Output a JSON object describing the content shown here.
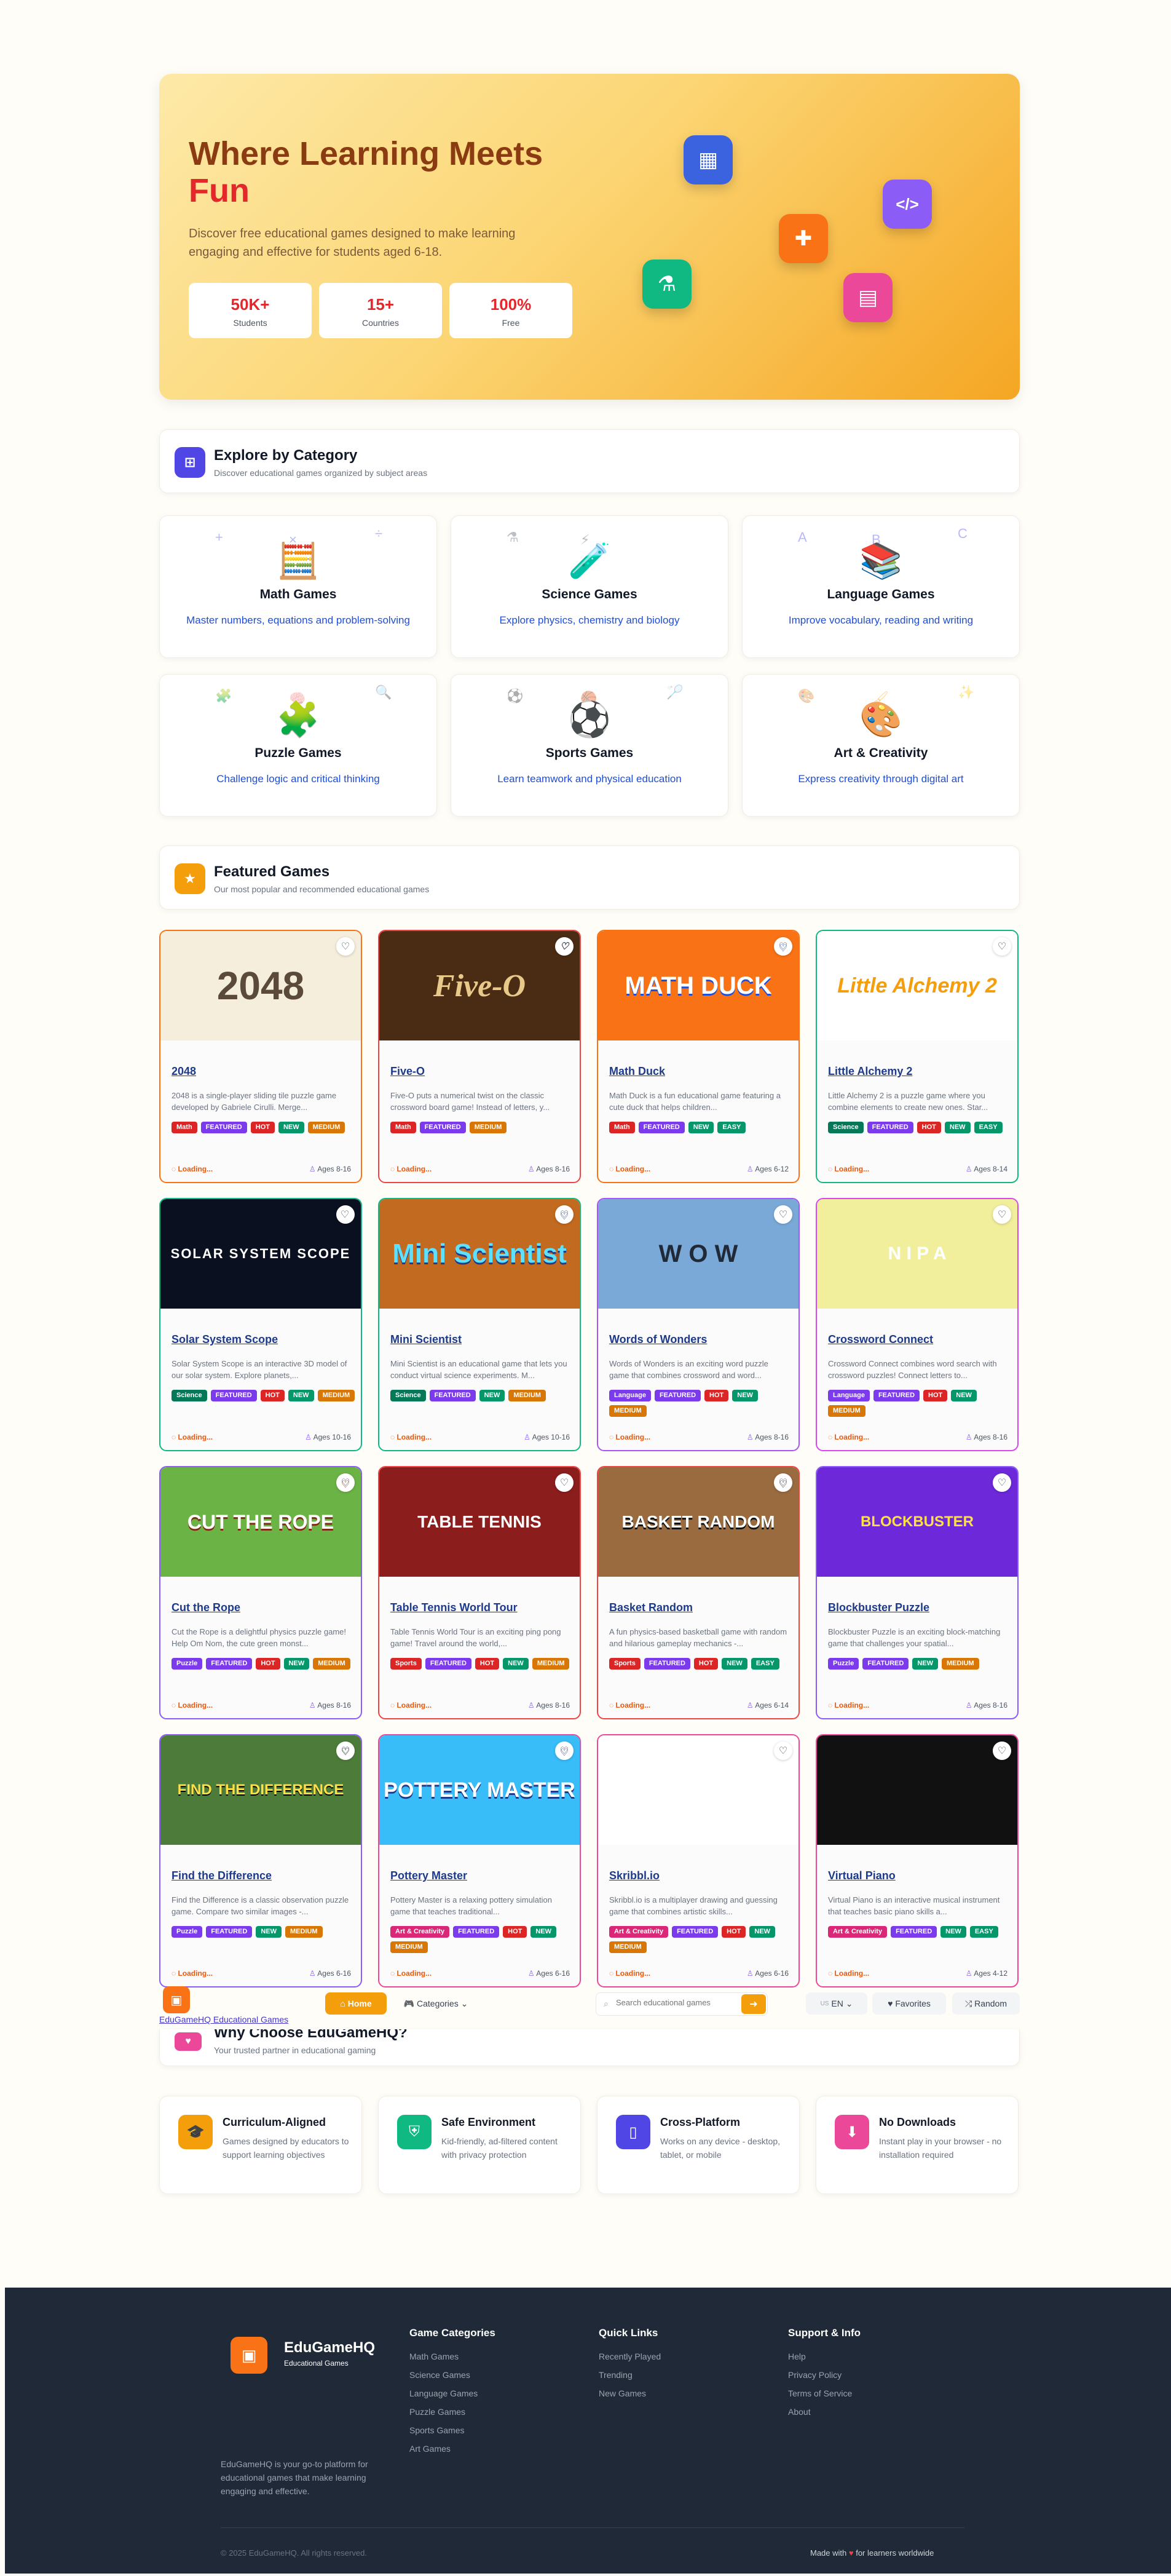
{
  "hero": {
    "title_line1": "Where Learning Meets",
    "title_line2": "Fun",
    "subtitle": "Discover free educational games designed to make learning engaging and effective for students aged 6-18.",
    "stats": [
      {
        "value": "50K+",
        "label": "Students"
      },
      {
        "value": "15+",
        "label": "Countries"
      },
      {
        "value": "100%",
        "label": "Free"
      }
    ],
    "icons": [
      "calculator-icon",
      "code-icon",
      "puzzle-icon",
      "flask-icon",
      "book-icon"
    ]
  },
  "categories_header": {
    "title": "Explore by Category",
    "subtitle": "Discover educational games organized by subject areas"
  },
  "categories": [
    {
      "name": "Math Games",
      "desc": "Master numbers, equations and problem-solving",
      "emoji": "🧮",
      "deco": [
        "+",
        "×",
        "÷"
      ]
    },
    {
      "name": "Science Games",
      "desc": "Explore physics, chemistry and biology",
      "emoji": "🧪",
      "deco": [
        "⚗",
        "⚡",
        ""
      ]
    },
    {
      "name": "Language Games",
      "desc": "Improve vocabulary, reading and writing",
      "emoji": "📚",
      "deco": [
        "A",
        "B",
        "C"
      ]
    },
    {
      "name": "Puzzle Games",
      "desc": "Challenge logic and critical thinking",
      "emoji": "🧩",
      "deco": [
        "🧩",
        "🧠",
        "🔍"
      ]
    },
    {
      "name": "Sports Games",
      "desc": "Learn teamwork and physical education",
      "emoji": "⚽",
      "deco": [
        "⚽",
        "🏀",
        "🏸"
      ]
    },
    {
      "name": "Art & Creativity",
      "desc": "Express creativity through digital art",
      "emoji": "🎨",
      "deco": [
        "🎨",
        "🖌",
        "✨"
      ]
    }
  ],
  "featured_header": {
    "title": "Featured Games",
    "subtitle": "Our most popular and recommended educational games"
  },
  "games": [
    {
      "title": "2048",
      "thumb": "2048",
      "desc": "2048 is a single-player sliding tile puzzle game developed by Gabriele Cirulli. Merge...",
      "tags": [
        "Math",
        "FEATURED",
        "HOT",
        "NEW",
        "MEDIUM"
      ],
      "ages": "Ages 8-16"
    },
    {
      "title": "Five-O",
      "thumb": "Five-O",
      "desc": "Five-O puts a numerical twist on the classic crossword board game! Instead of letters, y...",
      "tags": [
        "Math",
        "FEATURED",
        "MEDIUM"
      ],
      "ages": "Ages 8-16"
    },
    {
      "title": "Math Duck",
      "thumb": "MATH DUCK",
      "desc": "Math Duck is a fun educational game featuring a cute duck that helps children...",
      "tags": [
        "Math",
        "FEATURED",
        "NEW",
        "EASY"
      ],
      "ages": "Ages 6-12"
    },
    {
      "title": "Little Alchemy 2",
      "thumb": "Little Alchemy 2",
      "desc": "Little Alchemy 2 is a puzzle game where you combine elements to create new ones. Star...",
      "tags": [
        "Science",
        "FEATURED",
        "HOT",
        "NEW",
        "EASY"
      ],
      "ages": "Ages 8-14"
    },
    {
      "title": "Solar System Scope",
      "thumb": "SOLAR SYSTEM SCOPE",
      "desc": "Solar System Scope is an interactive 3D model of our solar system. Explore planets,...",
      "tags": [
        "Science",
        "FEATURED",
        "HOT",
        "NEW",
        "MEDIUM"
      ],
      "ages": "Ages 10-16"
    },
    {
      "title": "Mini Scientist",
      "thumb": "Mini Scientist",
      "desc": "Mini Scientist is an educational game that lets you conduct virtual science experiments. M...",
      "tags": [
        "Science",
        "FEATURED",
        "NEW",
        "MEDIUM"
      ],
      "ages": "Ages 10-16"
    },
    {
      "title": "Words of Wonders",
      "thumb": "W O W",
      "desc": "Words of Wonders is an exciting word puzzle game that combines crossword and word...",
      "tags": [
        "Language",
        "FEATURED",
        "HOT",
        "NEW",
        "MEDIUM"
      ],
      "ages": "Ages 8-16"
    },
    {
      "title": "Crossword Connect",
      "thumb": "N I P A",
      "desc": "Crossword Connect combines word search with crossword puzzles! Connect letters to...",
      "tags": [
        "Language",
        "FEATURED",
        "HOT",
        "NEW",
        "MEDIUM"
      ],
      "ages": "Ages 8-16"
    },
    {
      "title": "Cut the Rope",
      "thumb": "CUT THE ROPE",
      "desc": "Cut the Rope is a delightful physics puzzle game! Help Om Nom, the cute green monst...",
      "tags": [
        "Puzzle",
        "FEATURED",
        "HOT",
        "NEW",
        "MEDIUM"
      ],
      "ages": "Ages 8-16"
    },
    {
      "title": "Table Tennis World Tour",
      "thumb": "TABLE TENNIS",
      "desc": "Table Tennis World Tour is an exciting ping pong game! Travel around the world,...",
      "tags": [
        "Sports",
        "FEATURED",
        "HOT",
        "NEW",
        "MEDIUM"
      ],
      "ages": "Ages 8-16"
    },
    {
      "title": "Basket Random",
      "thumb": "BASKET RANDOM",
      "desc": "A fun physics-based basketball game with random and hilarious gameplay mechanics -...",
      "tags": [
        "Sports",
        "FEATURED",
        "HOT",
        "NEW",
        "EASY"
      ],
      "ages": "Ages 6-14"
    },
    {
      "title": "Blockbuster Puzzle",
      "thumb": "BLOCKBUSTER",
      "desc": "Blockbuster Puzzle is an exciting block-matching game that challenges your spatial...",
      "tags": [
        "Puzzle",
        "FEATURED",
        "NEW",
        "MEDIUM"
      ],
      "ages": "Ages 8-16"
    },
    {
      "title": "Find the Difference",
      "thumb": "FIND THE DIFFERENCE",
      "desc": "Find the Difference is a classic observation puzzle game. Compare two similar images -...",
      "tags": [
        "Puzzle",
        "FEATURED",
        "NEW",
        "MEDIUM"
      ],
      "ages": "Ages 6-16"
    },
    {
      "title": "Pottery Master",
      "thumb": "POTTERY MASTER",
      "desc": "Pottery Master is a relaxing pottery simulation game that teaches traditional...",
      "tags": [
        "Art & Creativity",
        "FEATURED",
        "HOT",
        "NEW",
        "MEDIUM"
      ],
      "ages": "Ages 6-16"
    },
    {
      "title": "Skribbl.io",
      "thumb": "",
      "desc": "Skribbl.io is a multiplayer drawing and guessing game that combines artistic skills...",
      "tags": [
        "Art & Creativity",
        "FEATURED",
        "HOT",
        "NEW",
        "MEDIUM"
      ],
      "ages": "Ages 6-16"
    },
    {
      "title": "Virtual Piano",
      "thumb": "",
      "desc": "Virtual Piano is an interactive musical instrument that teaches basic piano skills a...",
      "tags": [
        "Art & Creativity",
        "FEATURED",
        "NEW",
        "EASY"
      ],
      "ages": "Ages 4-12"
    }
  ],
  "loading_text": "Loading...",
  "navbar": {
    "logo_text": "EduGameHQ Educational Games",
    "home": "Home",
    "categories": "Categories",
    "search_placeholder": "Search educational games",
    "lang": "EN",
    "lang_code": "US",
    "favorites": "Favorites",
    "random": "Random"
  },
  "why": {
    "title": "Why Choose EduGameHQ?",
    "subtitle": "Your trusted partner in educational gaming",
    "features": [
      {
        "title": "Curriculum-Aligned",
        "desc": "Games designed by educators to support learning objectives"
      },
      {
        "title": "Safe Environment",
        "desc": "Kid-friendly, ad-filtered content with privacy protection"
      },
      {
        "title": "Cross-Platform",
        "desc": "Works on any device - desktop, tablet, or mobile"
      },
      {
        "title": "No Downloads",
        "desc": "Instant play in your browser - no installation required"
      }
    ]
  },
  "footer": {
    "brand": "EduGameHQ",
    "brand_sub": "Educational Games",
    "about": "EduGameHQ is your go-to platform for educational games that make learning engaging and effective.",
    "cols": [
      {
        "title": "Game Categories",
        "links": [
          "Math Games",
          "Science Games",
          "Language Games",
          "Puzzle Games",
          "Sports Games",
          "Art Games"
        ]
      },
      {
        "title": "Quick Links",
        "links": [
          "Recently Played",
          "Trending",
          "New Games"
        ]
      },
      {
        "title": "Support & Info",
        "links": [
          "Help",
          "Privacy Policy",
          "Terms of Service",
          "About"
        ]
      }
    ],
    "copyright": "© 2025 EduGameHQ. All rights reserved.",
    "made_with": "Made with",
    "made_for": "for learners worldwide"
  }
}
